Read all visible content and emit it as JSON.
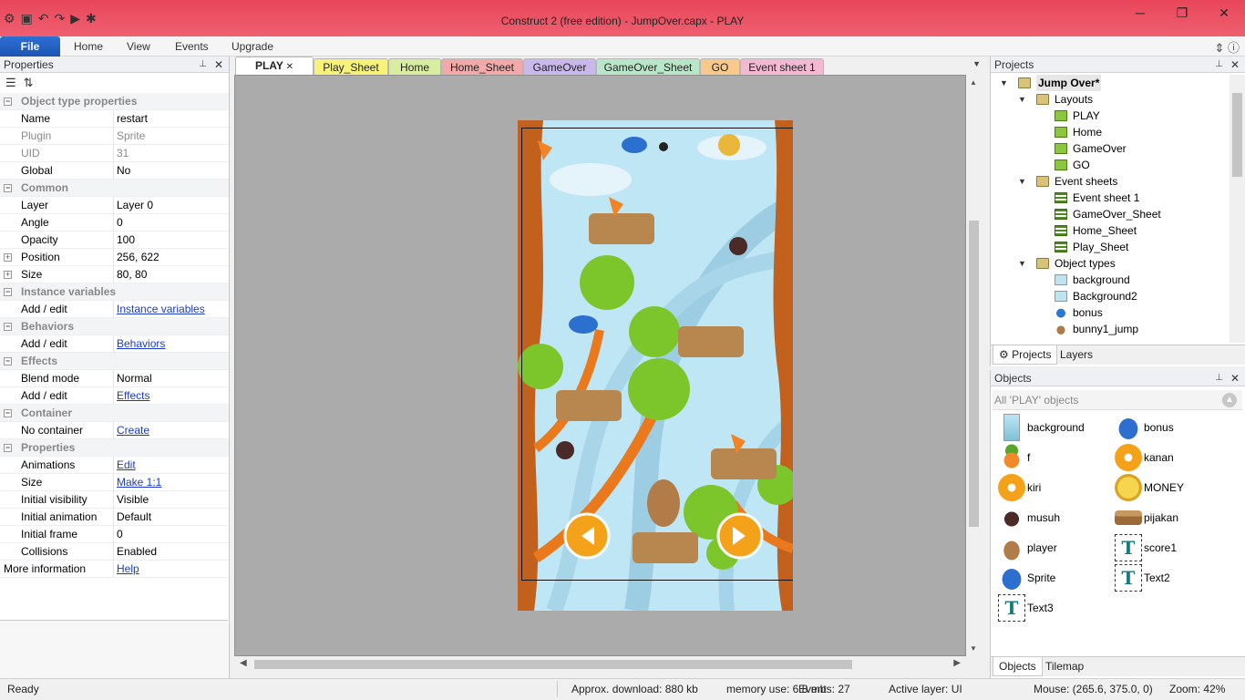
{
  "window": {
    "title": "Construct 2  (free edition) - JumpOver.capx - PLAY"
  },
  "ribbon": {
    "tabs": [
      "File",
      "Home",
      "View",
      "Events",
      "Upgrade"
    ]
  },
  "properties": {
    "title": "Properties",
    "rows": [
      {
        "type": "cat",
        "name": "Object type properties"
      },
      {
        "name": "Name",
        "value": "restart"
      },
      {
        "name": "Plugin",
        "value": "Sprite",
        "dim": true
      },
      {
        "name": "UID",
        "value": "31",
        "dim": true
      },
      {
        "name": "Global",
        "value": "No"
      },
      {
        "type": "cat",
        "name": "Common"
      },
      {
        "name": "Layer",
        "value": "Layer 0"
      },
      {
        "name": "Angle",
        "value": "0"
      },
      {
        "name": "Opacity",
        "value": "100"
      },
      {
        "name": "Position",
        "value": "256, 622",
        "expand": true
      },
      {
        "name": "Size",
        "value": "80, 80",
        "expand": true
      },
      {
        "type": "cat",
        "name": "Instance variables"
      },
      {
        "name": "Add / edit",
        "value": "Instance variables",
        "link": true
      },
      {
        "type": "cat",
        "name": "Behaviors"
      },
      {
        "name": "Add / edit",
        "value": "Behaviors",
        "link": true
      },
      {
        "type": "cat",
        "name": "Effects"
      },
      {
        "name": "Blend mode",
        "value": "Normal"
      },
      {
        "name": "Add / edit",
        "value": "Effects",
        "link": true
      },
      {
        "type": "cat",
        "name": "Container"
      },
      {
        "name": "No container",
        "value": "Create",
        "link": true
      },
      {
        "type": "cat",
        "name": "Properties"
      },
      {
        "name": "Animations",
        "value": "Edit",
        "link": true
      },
      {
        "name": "Size",
        "value": "Make 1:1",
        "link": true
      },
      {
        "name": "Initial visibility",
        "value": "Visible"
      },
      {
        "name": "Initial animation",
        "value": "Default"
      },
      {
        "name": "Initial frame",
        "value": "0"
      },
      {
        "name": "Collisions",
        "value": "Enabled"
      },
      {
        "type": "more",
        "name": "More information",
        "value": "Help",
        "link": true
      }
    ]
  },
  "doc_tabs": [
    {
      "label": "PLAY",
      "color": "#ffffff",
      "active": true
    },
    {
      "label": "Play_Sheet",
      "color": "#f7f27a"
    },
    {
      "label": "Home",
      "color": "#d8eda0"
    },
    {
      "label": "Home_Sheet",
      "color": "#f2a9a9"
    },
    {
      "label": "GameOver",
      "color": "#c9b8ec"
    },
    {
      "label": "GameOver_Sheet",
      "color": "#b9e6c8"
    },
    {
      "label": "GO",
      "color": "#f8c98a"
    },
    {
      "label": "Event sheet 1",
      "color": "#f4b9d2"
    }
  ],
  "projects": {
    "title": "Projects",
    "tree": [
      {
        "level": 0,
        "label": "Jump Over*",
        "icon": "folder",
        "bold": true,
        "tw": "v"
      },
      {
        "level": 1,
        "label": "Layouts",
        "icon": "folder",
        "tw": "v"
      },
      {
        "level": 2,
        "label": "PLAY",
        "icon": "layout"
      },
      {
        "level": 2,
        "label": "Home",
        "icon": "layout"
      },
      {
        "level": 2,
        "label": "GameOver",
        "icon": "layout"
      },
      {
        "level": 2,
        "label": "GO",
        "icon": "layout"
      },
      {
        "level": 1,
        "label": "Event sheets",
        "icon": "folder",
        "tw": "v"
      },
      {
        "level": 2,
        "label": "Event sheet 1",
        "icon": "sheet"
      },
      {
        "level": 2,
        "label": "GameOver_Sheet",
        "icon": "sheet"
      },
      {
        "level": 2,
        "label": "Home_Sheet",
        "icon": "sheet"
      },
      {
        "level": 2,
        "label": "Play_Sheet",
        "icon": "sheet"
      },
      {
        "level": 1,
        "label": "Object types",
        "icon": "folder",
        "tw": "v"
      },
      {
        "level": 2,
        "label": "background",
        "icon": "spr"
      },
      {
        "level": 2,
        "label": "Background2",
        "icon": "spr"
      },
      {
        "level": 2,
        "label": "bonus",
        "icon": "bird"
      },
      {
        "level": 2,
        "label": "bunny1_jump",
        "icon": "bunny"
      }
    ],
    "tabs": [
      "Projects",
      "Layers"
    ]
  },
  "objects": {
    "title": "Objects",
    "filter": "All 'PLAY' objects",
    "items": [
      {
        "label": "background",
        "icon": "bgth"
      },
      {
        "label": "bonus",
        "icon": "birdi"
      },
      {
        "label": "f",
        "icon": "carrot"
      },
      {
        "label": "kanan",
        "icon": "btnc"
      },
      {
        "label": "kiri",
        "icon": "btnc"
      },
      {
        "label": "MONEY",
        "icon": "coin"
      },
      {
        "label": "musuh",
        "icon": "musuh"
      },
      {
        "label": "pijakan",
        "icon": "plat"
      },
      {
        "label": "player",
        "icon": "bun"
      },
      {
        "label": "score1",
        "icon": "tx"
      },
      {
        "label": "Sprite",
        "icon": "birdi"
      },
      {
        "label": "Text2",
        "icon": "tx"
      },
      {
        "label": "Text3",
        "icon": "tx"
      }
    ],
    "tabs": [
      "Objects",
      "Tilemap"
    ]
  },
  "status": {
    "ready": "Ready",
    "download": "Approx. download: 880 kb",
    "memory": "memory use: 6.8 mb",
    "events": "Events: 27",
    "layer": "Active layer: UI",
    "mouse": "Mouse: (265.6, 375.0, 0)",
    "zoom": "Zoom: 42%"
  },
  "canvas_text": {
    "t": "T"
  }
}
